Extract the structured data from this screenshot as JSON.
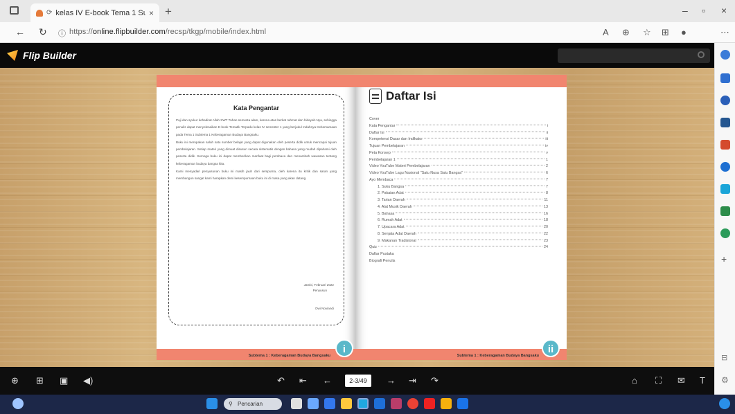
{
  "browser": {
    "tab_title": "kelas IV E-book Tema 1 Sub",
    "tab_close": "×",
    "new_tab": "+",
    "window_controls": [
      "–",
      "▫",
      "×"
    ],
    "url_prefix": "https://",
    "url_host": "online.flipbuilder.com",
    "url_path": "/recsp/tkgp/mobile/index.html"
  },
  "app": {
    "brand": "Flip Builder",
    "search_placeholder": ""
  },
  "book": {
    "left_page": {
      "title": "Kata Pengantar",
      "paragraphs": [
        "Puji dan syukur kehadirat Allah SWT Tuhan semesta alam, karena atas berkat rahmat dan hidayah-Nya, sehingga penulis dapat menyelesaikan E-book Tematik Terpadu kelas IV semester 1 yang berjudul Indahnya Kebersamaan pada Tema 1 Subtema 1 Keberagaman Budaya Bangsaku.",
        "Buku ini merupakan salah satu sumber belajar yang dapat digunakan oleh peserta didik untuk mencapai tujuan pembelajaran. Setiap materi yang dimuat disusun secara sistematis dengan bahasa yang mudah dipahami oleh peserta didik. Semoga buku ini dapat memberikan manfaat bagi pembaca dan menambah wawasan tentang keberagaman budaya bangsa kita.",
        "Kami menyadari penyusunan buku ini masih jauh dari sempurna, oleh karena itu kritik dan saran yang membangun sangat kami harapkan demi kesempurnaan buku ini di masa yang akan datang."
      ],
      "sign_place": "Jambi,    Februari 2022",
      "sign_role": "Penyusun",
      "sign_name": "Dwi Noviandi",
      "footer": "Subtema 1 : Keberagaman Budaya Bangsaku",
      "page_no": "i"
    },
    "right_page": {
      "title": "Daftar Isi",
      "toc": [
        {
          "label": "Cover",
          "page": "",
          "indent": false
        },
        {
          "label": "Kata Pengantar",
          "page": "i",
          "indent": false
        },
        {
          "label": "Daftar Isi",
          "page": "ii",
          "indent": false
        },
        {
          "label": "Kompetensi Dasar dan Indikator",
          "page": "iii",
          "indent": false
        },
        {
          "label": "Tujuan Pembelajaran",
          "page": "iv",
          "indent": false
        },
        {
          "label": "Peta Konsep",
          "page": "v",
          "indent": false
        },
        {
          "label": "Pembelajaran 1",
          "page": "1",
          "indent": false
        },
        {
          "label": "Video YouTube Materi Pembelajaran",
          "page": "2",
          "indent": false
        },
        {
          "label": "Video YouTube Lagu Nasional \"Satu Nusa Satu Bangsa\"",
          "page": "6",
          "indent": false
        },
        {
          "label": "Ayo Membaca",
          "page": "7",
          "indent": false
        },
        {
          "label": "1. Suku Bangsa",
          "page": "7",
          "indent": true
        },
        {
          "label": "2. Pakaian Adat",
          "page": "8",
          "indent": true
        },
        {
          "label": "3. Tarian Daerah",
          "page": "11",
          "indent": true
        },
        {
          "label": "4. Alat Musik Daerah",
          "page": "13",
          "indent": true
        },
        {
          "label": "5. Bahasa",
          "page": "16",
          "indent": true
        },
        {
          "label": "6. Rumah Adat",
          "page": "18",
          "indent": true
        },
        {
          "label": "7. Upacara Adat",
          "page": "20",
          "indent": true
        },
        {
          "label": "8. Senjata Adat Daerah",
          "page": "22",
          "indent": true
        },
        {
          "label": "9. Makanan Tradisional",
          "page": "23",
          "indent": true
        },
        {
          "label": "Quiz",
          "page": "24",
          "indent": false
        },
        {
          "label": "Daftar Pustaka",
          "page": "",
          "indent": false
        },
        {
          "label": "Biografi Penulis",
          "page": "",
          "indent": false
        }
      ],
      "footer": "Subtema 1 : Keberagaman Budaya Bangsaku",
      "page_no": "ii"
    }
  },
  "controls": {
    "page_indicator": "2-3/49"
  },
  "taskbar": {
    "search_label": "Pencarian"
  },
  "colors": {
    "accent_band": "#f1856f",
    "page_badge": "#5ab8c9",
    "app_header": "#0a0a0a"
  }
}
